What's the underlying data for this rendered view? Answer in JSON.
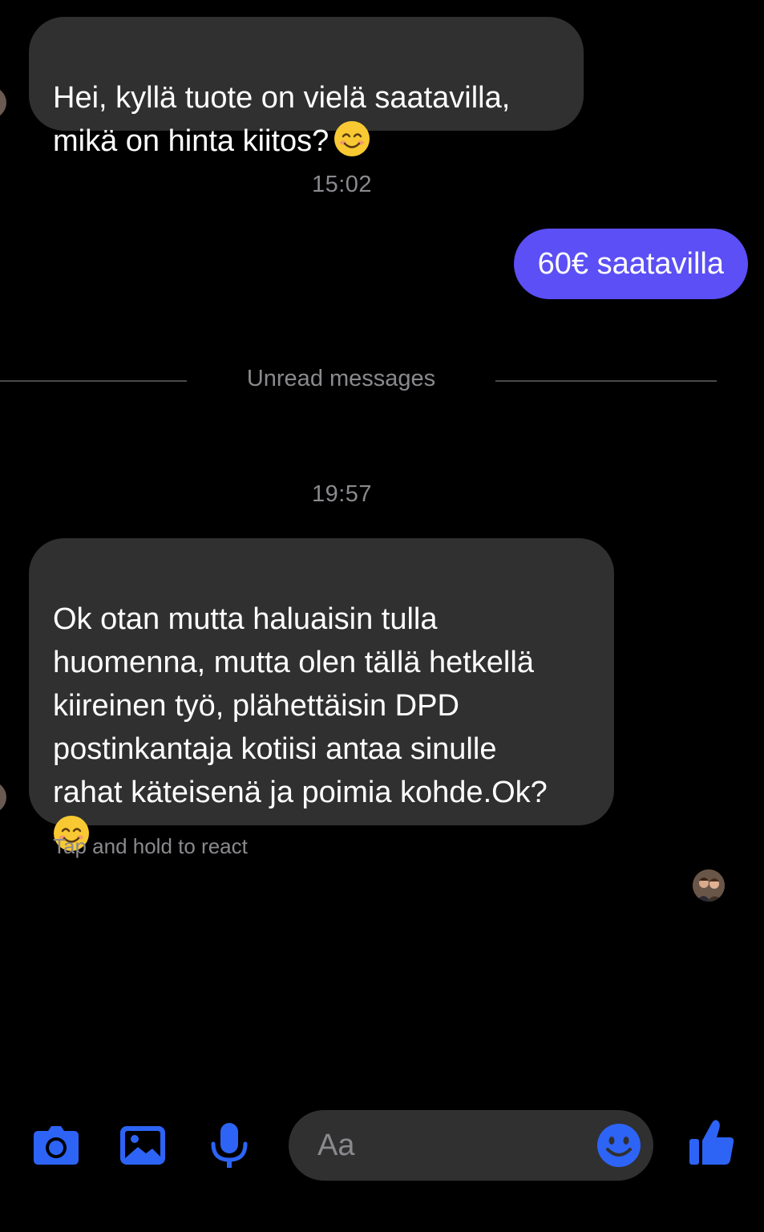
{
  "messages": [
    {
      "direction": "incoming",
      "text": "Hei, kyllä tuote on vielä saatavilla,\nmikä on hinta kiitos?",
      "emoji": "smiling-face-emoji"
    },
    {
      "direction": "outgoing",
      "text": "60€ saatavilla"
    },
    {
      "direction": "incoming",
      "text": "Ok otan mutta haluaisin tulla\nhuomenna, mutta olen tällä hetkellä\nkiireinen työ, plähettäisin DPD\npostinkantaja kotiisi antaa sinulle\nrahat käteisenä ja poimia kohde.Ok?",
      "emoji": "smiling-face-emoji"
    }
  ],
  "timestamps": [
    "15:02",
    "19:57"
  ],
  "divider": {
    "label": "Unread messages"
  },
  "react_hint": "Tap and hold to react",
  "composer": {
    "placeholder": "Aa"
  },
  "toolbar": {
    "icons": [
      "camera-icon",
      "gallery-icon",
      "microphone-icon",
      "emoji-icon",
      "thumbs-up-icon"
    ]
  },
  "colors": {
    "background": "#000000",
    "incoming_bubble": "#303030",
    "outgoing_bubble": "#5b4ff5",
    "accent_icon": "#2d64f5",
    "muted_text": "#8a8a8e"
  }
}
